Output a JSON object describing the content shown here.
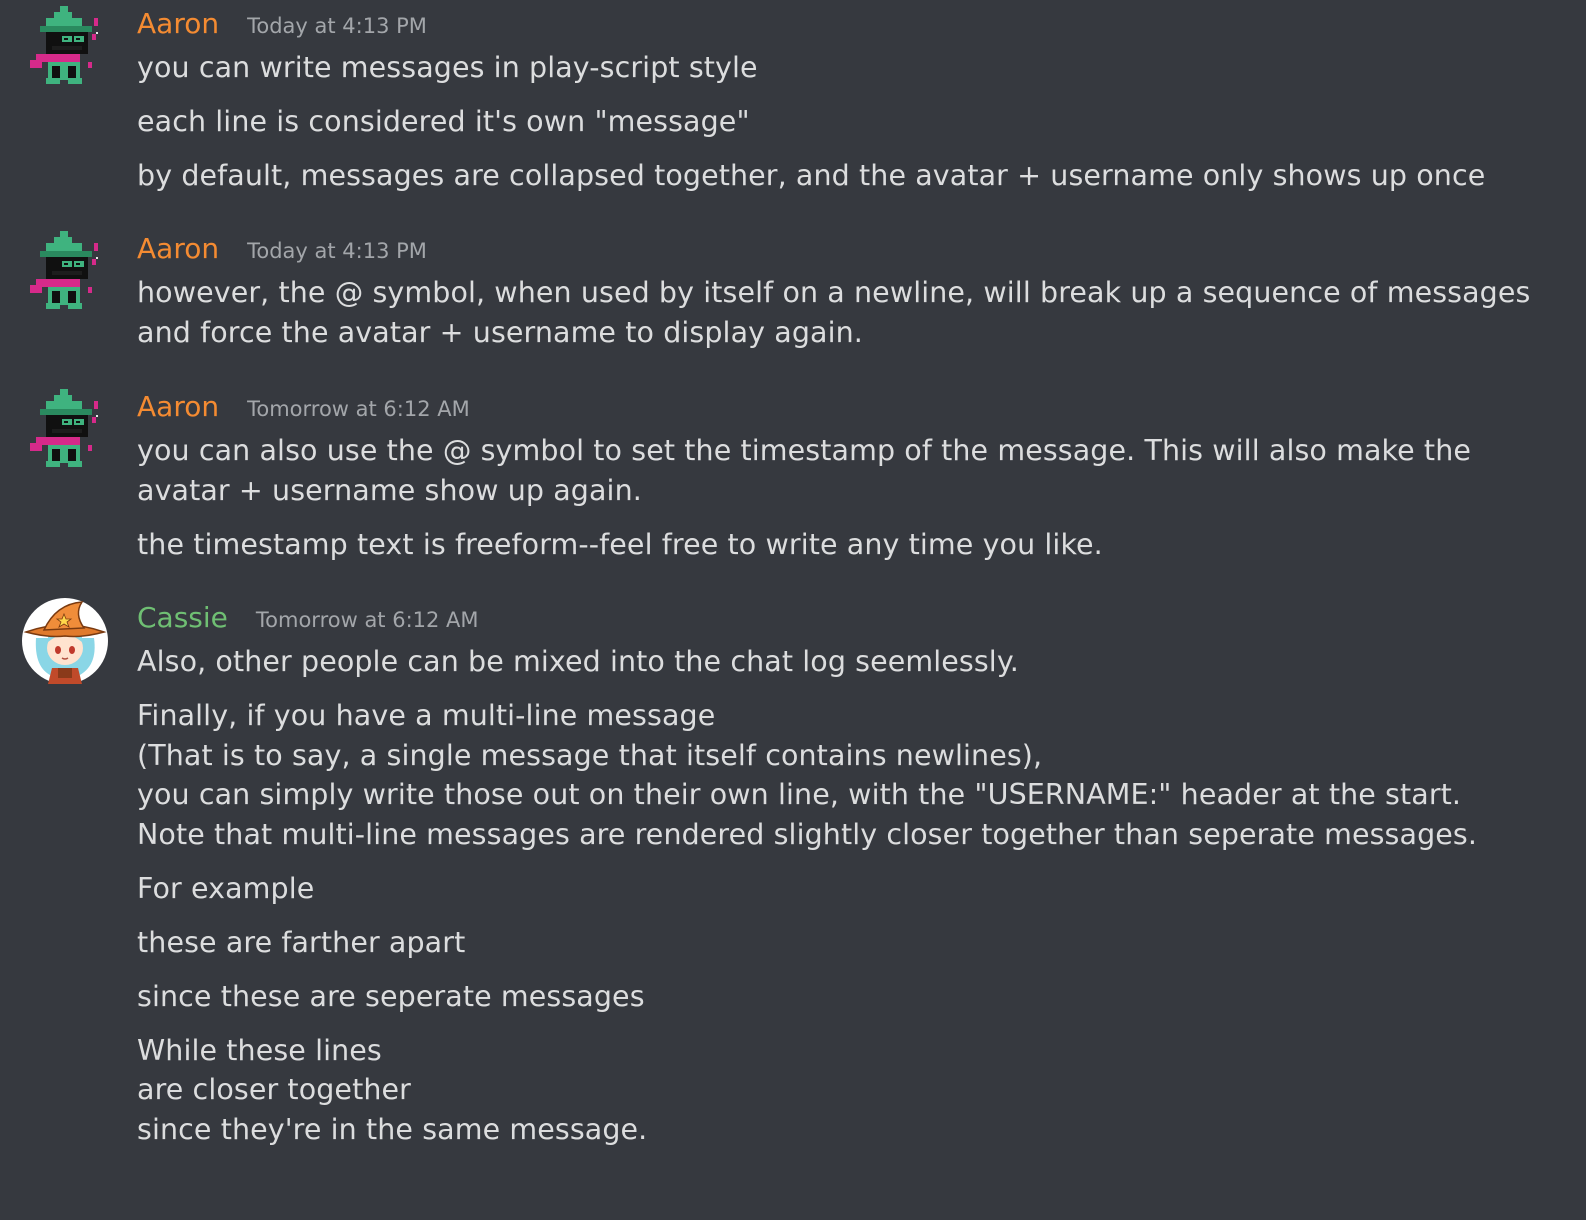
{
  "groups": [
    {
      "user": "Aaron",
      "color": "#f48b32",
      "avatar": "pixel-wizard-icon",
      "time": "Today at 4:13 PM",
      "messages": [
        "you can write messages in play-script style",
        "each line is considered it's own \"message\"",
        "by default, messages are collapsed together, and the avatar + username only shows up once"
      ]
    },
    {
      "user": "Aaron",
      "color": "#f48b32",
      "avatar": "pixel-wizard-icon",
      "time": "Today at 4:13 PM",
      "messages": [
        "however, the @ symbol, when used by itself on a newline, will break up a sequence of messages and force the avatar + username to display again."
      ]
    },
    {
      "user": "Aaron",
      "color": "#f48b32",
      "avatar": "pixel-wizard-icon",
      "time": "Tomorrow at 6:12 AM",
      "messages": [
        "you can also use the @ symbol to set the timestamp of the message. This will also make the avatar + username show up again.",
        "the timestamp text is freeform--feel free to write any time you like."
      ]
    },
    {
      "user": "Cassie",
      "color": "#6fbf73",
      "avatar": "witch-portrait-icon",
      "time": "Tomorrow at 6:12 AM",
      "messages": [
        "Also, other people can be mixed into the chat log seemlessly.",
        "Finally, if you have a multi-line message\n(That is to say, a single message that itself contains newlines),\nyou can simply write those out on their own line, with the \"USERNAME:\" header at the start.\nNote that multi-line messages are rendered slightly closer together than seperate messages.",
        "For example",
        "these are farther apart",
        "since these are seperate messages",
        "While these lines\nare closer together\nsince they're in the same message."
      ]
    }
  ]
}
